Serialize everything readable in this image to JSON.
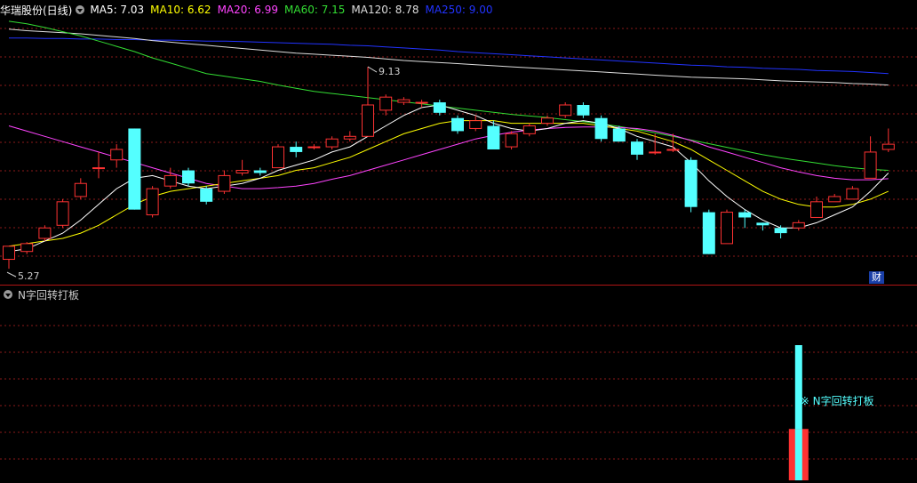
{
  "header": {
    "stock_name": "华瑞股份(日线)",
    "ma_items": [
      {
        "label": "MA5: 7.03",
        "color": "#ffffff"
      },
      {
        "label": "MA10: 6.62",
        "color": "#ffff00"
      },
      {
        "label": "MA20: 6.99",
        "color": "#ff44ff"
      },
      {
        "label": "MA60: 7.15",
        "color": "#33dd33"
      },
      {
        "label": "MA120: 8.78",
        "color": "#dddddd"
      },
      {
        "label": "MA250: 9.00",
        "color": "#2233ff"
      }
    ]
  },
  "indicator": {
    "title": "N字回转打板",
    "signal_label": "※ N字回转打板"
  },
  "badge": "财",
  "price_labels": {
    "high": "9.13",
    "low": "5.27"
  },
  "colors": {
    "up": "#ff3232",
    "down": "#54ffff",
    "grid": "#8b1a1a",
    "frame": "#b01414"
  },
  "chart_data": {
    "type": "candlestick",
    "candles": [
      [
        5.45,
        5.7,
        5.7,
        5.27
      ],
      [
        5.6,
        5.75,
        5.78,
        5.55
      ],
      [
        5.85,
        6.05,
        6.1,
        5.8
      ],
      [
        6.1,
        6.55,
        6.6,
        6.05
      ],
      [
        6.65,
        6.9,
        7.0,
        6.6
      ],
      [
        7.2,
        7.2,
        7.5,
        7.0
      ],
      [
        7.35,
        7.55,
        7.65,
        7.2
      ],
      [
        7.95,
        6.4,
        7.95,
        6.4
      ],
      [
        6.3,
        6.8,
        6.85,
        6.25
      ],
      [
        6.85,
        7.05,
        7.2,
        6.8
      ],
      [
        7.15,
        6.9,
        7.2,
        6.85
      ],
      [
        6.8,
        6.55,
        6.85,
        6.5
      ],
      [
        6.75,
        7.05,
        7.15,
        6.7
      ],
      [
        7.1,
        7.15,
        7.35,
        7.05
      ],
      [
        7.15,
        7.1,
        7.2,
        7.05
      ],
      [
        7.2,
        7.6,
        7.65,
        7.2
      ],
      [
        7.6,
        7.5,
        7.7,
        7.4
      ],
      [
        7.6,
        7.6,
        7.65,
        7.55
      ],
      [
        7.6,
        7.75,
        7.8,
        7.55
      ],
      [
        7.75,
        7.8,
        7.9,
        7.7
      ],
      [
        7.8,
        8.4,
        9.13,
        7.8
      ],
      [
        8.3,
        8.55,
        8.6,
        8.2
      ],
      [
        8.45,
        8.5,
        8.55,
        8.4
      ],
      [
        8.45,
        8.45,
        8.5,
        8.35
      ],
      [
        8.45,
        8.25,
        8.5,
        8.2
      ],
      [
        8.15,
        7.9,
        8.2,
        7.85
      ],
      [
        7.95,
        8.1,
        8.2,
        7.9
      ],
      [
        8.0,
        7.55,
        8.1,
        7.55
      ],
      [
        7.6,
        7.85,
        7.9,
        7.55
      ],
      [
        7.85,
        8.0,
        8.05,
        7.8
      ],
      [
        8.05,
        8.15,
        8.2,
        8.0
      ],
      [
        8.2,
        8.4,
        8.45,
        8.15
      ],
      [
        8.4,
        8.2,
        8.45,
        8.15
      ],
      [
        8.15,
        7.75,
        8.2,
        7.7
      ],
      [
        7.95,
        7.7,
        8.0,
        7.7
      ],
      [
        7.7,
        7.45,
        7.75,
        7.35
      ],
      [
        7.5,
        7.5,
        7.85,
        7.45
      ],
      [
        7.55,
        7.55,
        7.85,
        7.5
      ],
      [
        7.35,
        6.45,
        7.4,
        6.35
      ],
      [
        6.35,
        5.55,
        6.4,
        5.55
      ],
      [
        5.75,
        6.35,
        6.4,
        5.75
      ],
      [
        6.35,
        6.25,
        6.4,
        6.05
      ],
      [
        6.15,
        6.1,
        6.15,
        6.0
      ],
      [
        6.05,
        5.95,
        6.1,
        5.85
      ],
      [
        6.05,
        6.15,
        6.2,
        6.0
      ],
      [
        6.25,
        6.55,
        6.65,
        6.25
      ],
      [
        6.55,
        6.65,
        6.7,
        6.55
      ],
      [
        6.6,
        6.8,
        6.85,
        6.6
      ],
      [
        7.0,
        7.5,
        7.8,
        7.0
      ],
      [
        7.55,
        7.65,
        7.95,
        7.5
      ]
    ],
    "ma5": [
      5.6,
      5.65,
      5.8,
      5.95,
      6.2,
      6.5,
      6.8,
      7.0,
      7.05,
      6.95,
      6.85,
      6.8,
      6.85,
      6.9,
      7.0,
      7.15,
      7.25,
      7.35,
      7.5,
      7.6,
      7.8,
      8.0,
      8.2,
      8.35,
      8.4,
      8.3,
      8.2,
      8.05,
      7.95,
      7.9,
      7.95,
      8.05,
      8.1,
      8.05,
      7.95,
      7.8,
      7.7,
      7.6,
      7.3,
      6.95,
      6.65,
      6.4,
      6.2,
      6.05,
      6.05,
      6.15,
      6.3,
      6.45,
      6.75,
      7.1
    ],
    "ma10": [
      5.7,
      5.75,
      5.8,
      5.85,
      5.95,
      6.1,
      6.3,
      6.5,
      6.65,
      6.75,
      6.8,
      6.85,
      6.9,
      6.95,
      7.0,
      7.05,
      7.15,
      7.2,
      7.3,
      7.4,
      7.55,
      7.7,
      7.85,
      7.95,
      8.05,
      8.1,
      8.1,
      8.1,
      8.05,
      8.05,
      8.05,
      8.05,
      8.05,
      8.0,
      7.95,
      7.9,
      7.8,
      7.7,
      7.55,
      7.35,
      7.15,
      6.95,
      6.75,
      6.6,
      6.5,
      6.45,
      6.45,
      6.5,
      6.6,
      6.75
    ],
    "ma20": [
      8.0,
      7.9,
      7.8,
      7.7,
      7.6,
      7.5,
      7.4,
      7.3,
      7.2,
      7.1,
      7.0,
      6.9,
      6.85,
      6.8,
      6.8,
      6.82,
      6.85,
      6.9,
      6.98,
      7.05,
      7.15,
      7.25,
      7.35,
      7.45,
      7.55,
      7.65,
      7.75,
      7.82,
      7.88,
      7.92,
      7.95,
      7.97,
      7.98,
      7.98,
      7.97,
      7.95,
      7.9,
      7.82,
      7.72,
      7.6,
      7.5,
      7.4,
      7.3,
      7.2,
      7.12,
      7.05,
      7.0,
      6.97,
      6.97,
      6.99
    ],
    "ma60": [
      10.0,
      9.95,
      9.88,
      9.8,
      9.72,
      9.62,
      9.52,
      9.42,
      9.3,
      9.2,
      9.1,
      9.0,
      8.95,
      8.9,
      8.85,
      8.78,
      8.72,
      8.66,
      8.62,
      8.58,
      8.54,
      8.5,
      8.46,
      8.42,
      8.38,
      8.34,
      8.3,
      8.26,
      8.22,
      8.19,
      8.16,
      8.12,
      8.08,
      8.04,
      7.99,
      7.93,
      7.87,
      7.8,
      7.73,
      7.66,
      7.59,
      7.52,
      7.45,
      7.39,
      7.34,
      7.29,
      7.24,
      7.2,
      7.17,
      7.15
    ],
    "ma120": [
      9.85,
      9.82,
      9.8,
      9.78,
      9.76,
      9.73,
      9.7,
      9.67,
      9.63,
      9.6,
      9.57,
      9.54,
      9.51,
      9.48,
      9.45,
      9.42,
      9.39,
      9.37,
      9.35,
      9.33,
      9.31,
      9.28,
      9.25,
      9.23,
      9.21,
      9.19,
      9.17,
      9.15,
      9.13,
      9.11,
      9.09,
      9.07,
      9.05,
      9.03,
      9.01,
      8.99,
      8.97,
      8.95,
      8.93,
      8.92,
      8.91,
      8.9,
      8.88,
      8.86,
      8.85,
      8.84,
      8.83,
      8.81,
      8.8,
      8.78
    ],
    "ma250": [
      9.68,
      9.68,
      9.67,
      9.67,
      9.66,
      9.66,
      9.65,
      9.65,
      9.64,
      9.64,
      9.63,
      9.62,
      9.62,
      9.61,
      9.6,
      9.59,
      9.58,
      9.57,
      9.56,
      9.54,
      9.53,
      9.51,
      9.49,
      9.47,
      9.45,
      9.42,
      9.4,
      9.38,
      9.36,
      9.34,
      9.32,
      9.3,
      9.28,
      9.26,
      9.24,
      9.22,
      9.2,
      9.18,
      9.16,
      9.15,
      9.13,
      9.12,
      9.1,
      9.09,
      9.08,
      9.06,
      9.05,
      9.04,
      9.02,
      9.0
    ],
    "price_range": [
      5.0,
      10.1
    ],
    "signal": {
      "index": 44,
      "cyan": 1.0,
      "red": 0.38
    }
  }
}
